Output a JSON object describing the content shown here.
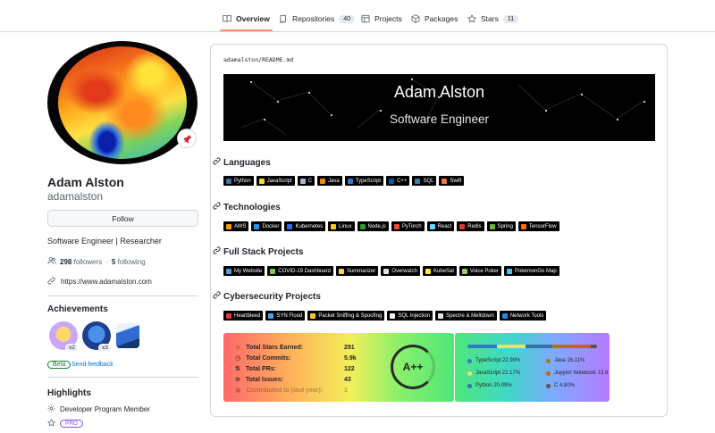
{
  "nav": {
    "tabs": [
      {
        "label": "Overview",
        "icon": "book-icon"
      },
      {
        "label": "Repositories",
        "icon": "repo-icon",
        "count": "40"
      },
      {
        "label": "Projects",
        "icon": "table-icon"
      },
      {
        "label": "Packages",
        "icon": "package-icon"
      },
      {
        "label": "Stars",
        "icon": "star-icon",
        "count": "11"
      }
    ],
    "accent": "#fd8c73"
  },
  "profile": {
    "name": "Adam Alston",
    "login": "adamalston",
    "follow_label": "Follow",
    "bio": "Software Engineer | Researcher",
    "followers_count": "298",
    "followers_label": "followers",
    "following_count": "5",
    "following_label": "following",
    "website": "https://www.adamalston.com"
  },
  "achievements": {
    "title": "Achievements",
    "items": [
      {
        "icon": "pull-shark-icon",
        "count": "x2"
      },
      {
        "icon": "quickdraw-icon",
        "count": "x3"
      },
      {
        "icon": "arctic-vault-icon"
      }
    ],
    "beta_label": "Beta",
    "feedback_label": "Send feedback"
  },
  "highlights": {
    "title": "Highlights",
    "program": "Developer Program Member",
    "pro_label": "PRO"
  },
  "readme": {
    "path_user": "adamalston",
    "path_sep": "/",
    "path_file": "README.md",
    "banner_title": "Adam Alston",
    "banner_subtitle": "Software Engineer",
    "sections": [
      {
        "title": "Languages",
        "badges": [
          {
            "label": "Python",
            "color": "#3776ab"
          },
          {
            "label": "JavaScript",
            "color": "#f7df1e"
          },
          {
            "label": "C",
            "color": "#a8b9cc"
          },
          {
            "label": "Java",
            "color": "#ed8b00"
          },
          {
            "label": "TypeScript",
            "color": "#3178c6"
          },
          {
            "label": "C++",
            "color": "#00599c"
          },
          {
            "label": "SQL",
            "color": "#4479a1"
          },
          {
            "label": "Swift",
            "color": "#fa7343"
          }
        ]
      },
      {
        "title": "Technologies",
        "badges": [
          {
            "label": "AWS",
            "color": "#ff9900"
          },
          {
            "label": "Docker",
            "color": "#2496ed"
          },
          {
            "label": "Kubernetes",
            "color": "#326ce5"
          },
          {
            "label": "Linux",
            "color": "#fcc624"
          },
          {
            "label": "Node.js",
            "color": "#339933"
          },
          {
            "label": "PyTorch",
            "color": "#ee4c2c"
          },
          {
            "label": "React",
            "color": "#61dafb"
          },
          {
            "label": "Redis",
            "color": "#dc382d"
          },
          {
            "label": "Spring",
            "color": "#6db33f"
          },
          {
            "label": "TensorFlow",
            "color": "#ff6f00"
          }
        ]
      },
      {
        "title": "Full Stack Projects",
        "badges": [
          {
            "label": "My Website",
            "color": "#5a9bd5"
          },
          {
            "label": "COVID-19 Dashboard",
            "color": "#8bc34a"
          },
          {
            "label": "Summarizer",
            "color": "#ffd54f"
          },
          {
            "label": "Overwatch",
            "color": "#e0e0e0"
          },
          {
            "label": "KubeSat",
            "color": "#ffeb3b"
          },
          {
            "label": "Voice Poker",
            "color": "#9ccc65"
          },
          {
            "label": "PokémonGo Map",
            "color": "#4fc3f7"
          }
        ]
      },
      {
        "title": "Cybersecurity Projects",
        "badges": [
          {
            "label": "Heartbleed",
            "color": "#e53935"
          },
          {
            "label": "SYN Flood",
            "color": "#42a5f5"
          },
          {
            "label": "Packet Sniffing & Spoofing",
            "color": "#ffca28"
          },
          {
            "label": "SQL Injection",
            "color": "#eeeeee"
          },
          {
            "label": "Spectre & Meltdown",
            "color": "#e0e0e0"
          },
          {
            "label": "Network Tools",
            "color": "#1e88e5"
          }
        ]
      }
    ],
    "stats": {
      "rows": [
        {
          "label": "Total Stars Earned:",
          "value": "291",
          "icon": "star-icon"
        },
        {
          "label": "Total Commits:",
          "value": "5.9k",
          "icon": "history-icon"
        },
        {
          "label": "Total PRs:",
          "value": "122",
          "icon": "pull-request-icon"
        },
        {
          "label": "Total Issues:",
          "value": "43",
          "icon": "issue-icon"
        },
        {
          "label": "Contributed to (last year):",
          "value": "1",
          "icon": "repo-icon"
        }
      ],
      "grade": "A++"
    },
    "top_langs": {
      "items": [
        {
          "label": "TypeScript 22.90%",
          "color": "#3178c6",
          "percent": 22.9
        },
        {
          "label": "Java 16.11%",
          "color": "#b07219",
          "percent": 16.11
        },
        {
          "label": "JavaScript 22.17%",
          "color": "#f1e05a",
          "percent": 22.17
        },
        {
          "label": "Jupyter Notebook 13.9",
          "color": "#da5b0b",
          "percent": 13.9
        },
        {
          "label": "Python 20.09%",
          "color": "#3572a5",
          "percent": 20.09
        },
        {
          "label": "C 4.80%",
          "color": "#555555",
          "percent": 4.8
        }
      ]
    }
  }
}
